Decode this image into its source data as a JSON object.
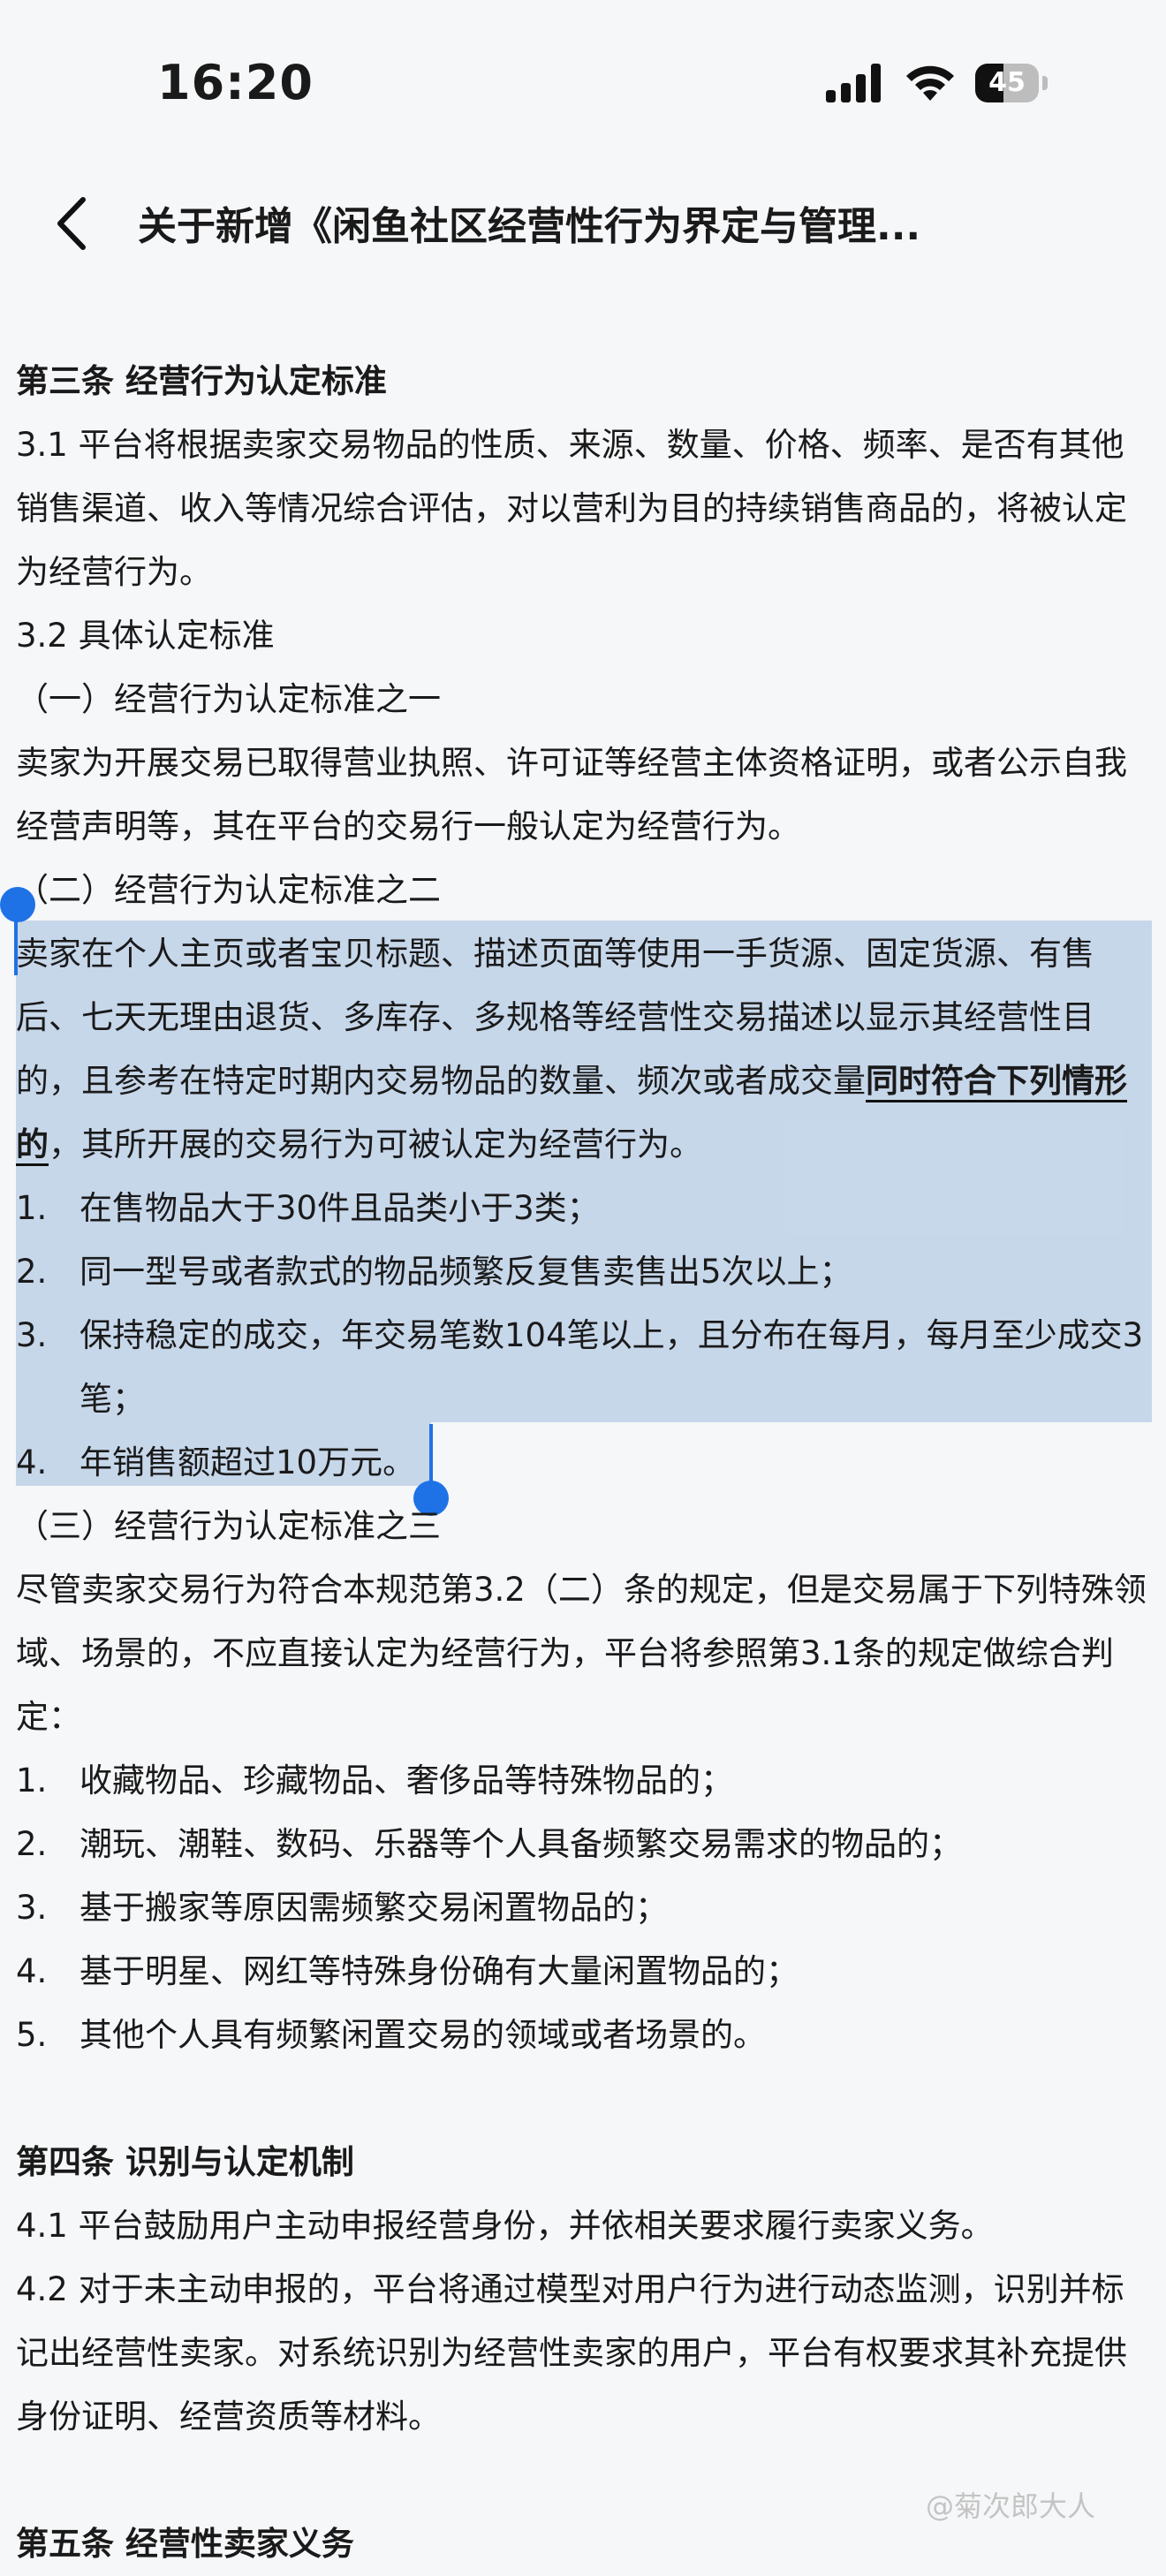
{
  "status": {
    "time": "16:20",
    "battery": "45",
    "battery_level": 0.45
  },
  "nav": {
    "title": "关于新增《闲鱼社区经营性行为界定与管理..."
  },
  "sections": {
    "s3_title": "第三条 经营行为认定标准",
    "s3_1": "3.1 平台将根据卖家交易物品的性质、来源、数量、价格、频率、是否有其他销售渠道、收入等情况综合评估，对以营利为目的持续销售商品的，将被认定为经营行为。",
    "s3_2": "3.2 具体认定标准",
    "std1_title": "（一）经营行为认定标准之一",
    "std1_body": "卖家为开展交易已取得营业执照、许可证等经营主体资格证明，或者公示自我经营声明等，其在平台的交易行一般认定为经营行为。",
    "std2_title": "（二）经营行为认定标准之二",
    "std2_body_a": "卖家在个人主页或者宝贝标题、描述页面等使用一手货源、固定货源、有售后、七天无理由退货、多库存、多规格等经营性交易描述以显示其经营性目的，且参考在特定时期内交易物品的数量、频次或者成交量",
    "std2_body_bold": "同时符合下列情形的",
    "std2_body_b": "，其所开展的交易行为可被认定为经营行为。",
    "std2_items": [
      {
        "num": "1.",
        "text": "在售物品大于30件且品类小于3类；"
      },
      {
        "num": "2.",
        "text": "同一型号或者款式的物品频繁反复售卖售出5次以上；"
      },
      {
        "num": "3.",
        "text": "保持稳定的成交，年交易笔数104笔以上，且分布在每月，每月至少成交3笔；"
      },
      {
        "num": "4.",
        "text": "年销售额超过10万元。"
      }
    ],
    "std3_title": "（三）经营行为认定标准之三",
    "std3_body": "尽管卖家交易行为符合本规范第3.2（二）条的规定，但是交易属于下列特殊领域、场景的，不应直接认定为经营行为，平台将参照第3.1条的规定做综合判定：",
    "std3_items": [
      {
        "num": "1.",
        "text": "收藏物品、珍藏物品、奢侈品等特殊物品的；"
      },
      {
        "num": "2.",
        "text": "潮玩、潮鞋、数码、乐器等个人具备频繁交易需求的物品的；"
      },
      {
        "num": "3.",
        "text": "基于搬家等原因需频繁交易闲置物品的；"
      },
      {
        "num": "4.",
        "text": "基于明星、网红等特殊身份确有大量闲置物品的；"
      },
      {
        "num": "5.",
        "text": "其他个人具有频繁闲置交易的领域或者场景的。"
      }
    ],
    "s4_title": "第四条 识别与认定机制",
    "s4_1": "4.1 平台鼓励用户主动申报经营身份，并依相关要求履行卖家义务。",
    "s4_2": "4.2 对于未主动申报的，平台将通过模型对用户行为进行动态监测，识别并标记出经营性卖家。对系统识别为经营性卖家的用户，平台有权要求其补充提供身份证明、经营资质等材料。",
    "s5_title": "第五条 经营性卖家义务"
  },
  "watermark": "@菊次郎大人"
}
